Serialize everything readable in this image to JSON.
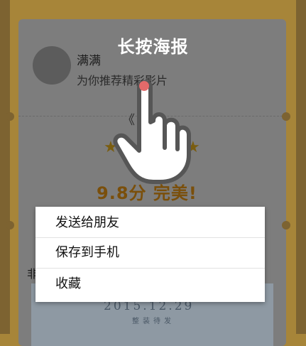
{
  "overlay": {
    "hint": "长按海报"
  },
  "poster_card": {
    "user_name": "满满",
    "user_subtitle": "为你推荐精彩影片",
    "movie_title_fragment": "《",
    "score_text": "9.8分 完美!",
    "side_text_fragment": "非",
    "poster_date": "2015.12.29",
    "poster_tag": "整装待发"
  },
  "context_menu": {
    "items": [
      {
        "label": "发送给朋友"
      },
      {
        "label": "保存到手机"
      },
      {
        "label": "收藏"
      }
    ]
  },
  "colors": {
    "frame": "#a78539",
    "card_dimmed": "#7d7d7d",
    "score": "#7a4f0b",
    "menu_bg": "#ffffff",
    "touch_dot": "#e36a6a"
  }
}
